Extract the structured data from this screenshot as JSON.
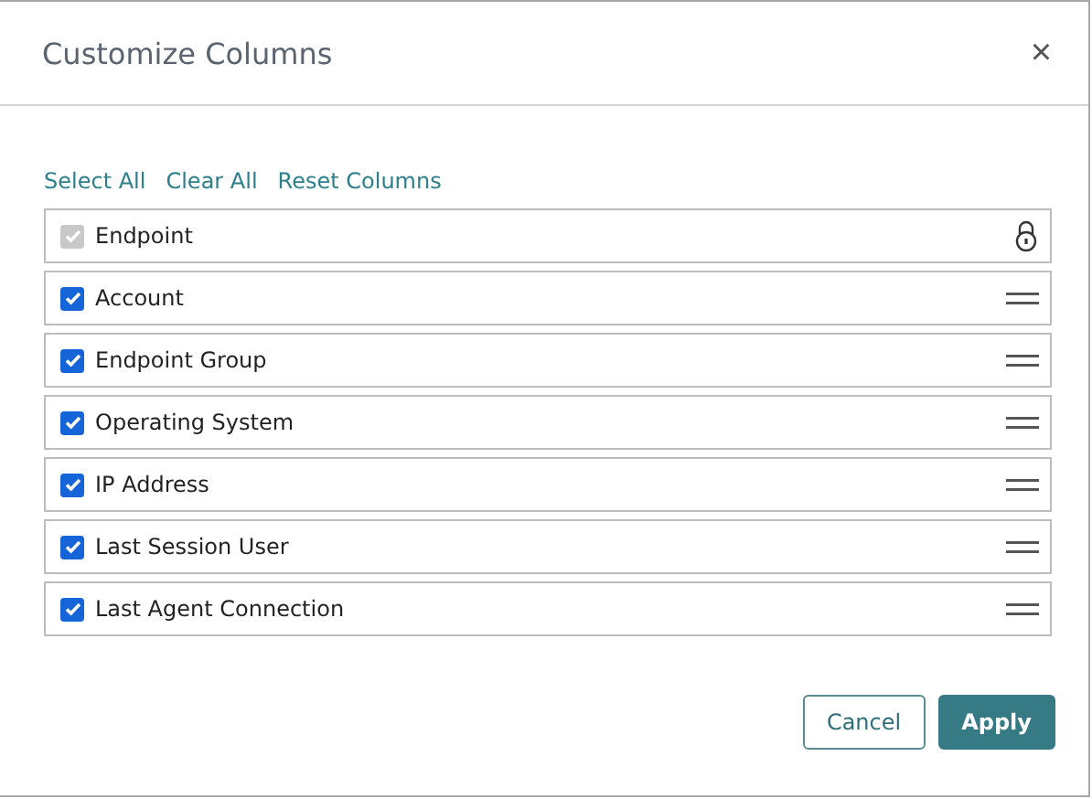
{
  "dialog": {
    "title": "Customize Columns",
    "close": "×"
  },
  "links": [
    "Select All",
    "Clear All",
    "Reset Columns"
  ],
  "columns": [
    {
      "label": "Endpoint",
      "checked": true,
      "disabled": true,
      "kind": "locked"
    },
    {
      "label": "Account",
      "checked": true,
      "disabled": false,
      "kind": "movable"
    },
    {
      "label": "Endpoint Group",
      "checked": true,
      "disabled": false,
      "kind": "movable"
    },
    {
      "label": "Operating System",
      "checked": true,
      "disabled": false,
      "kind": "movable"
    },
    {
      "label": "IP Address",
      "checked": true,
      "disabled": false,
      "kind": "movable"
    },
    {
      "label": "Last Session User",
      "checked": true,
      "disabled": false,
      "kind": "movable"
    },
    {
      "label": "Last Agent Connection",
      "checked": true,
      "disabled": false,
      "kind": "movable"
    }
  ],
  "buttons": [
    {
      "label": "Cancel",
      "kind": "secondary"
    },
    {
      "label": "Apply",
      "kind": "primary"
    }
  ]
}
